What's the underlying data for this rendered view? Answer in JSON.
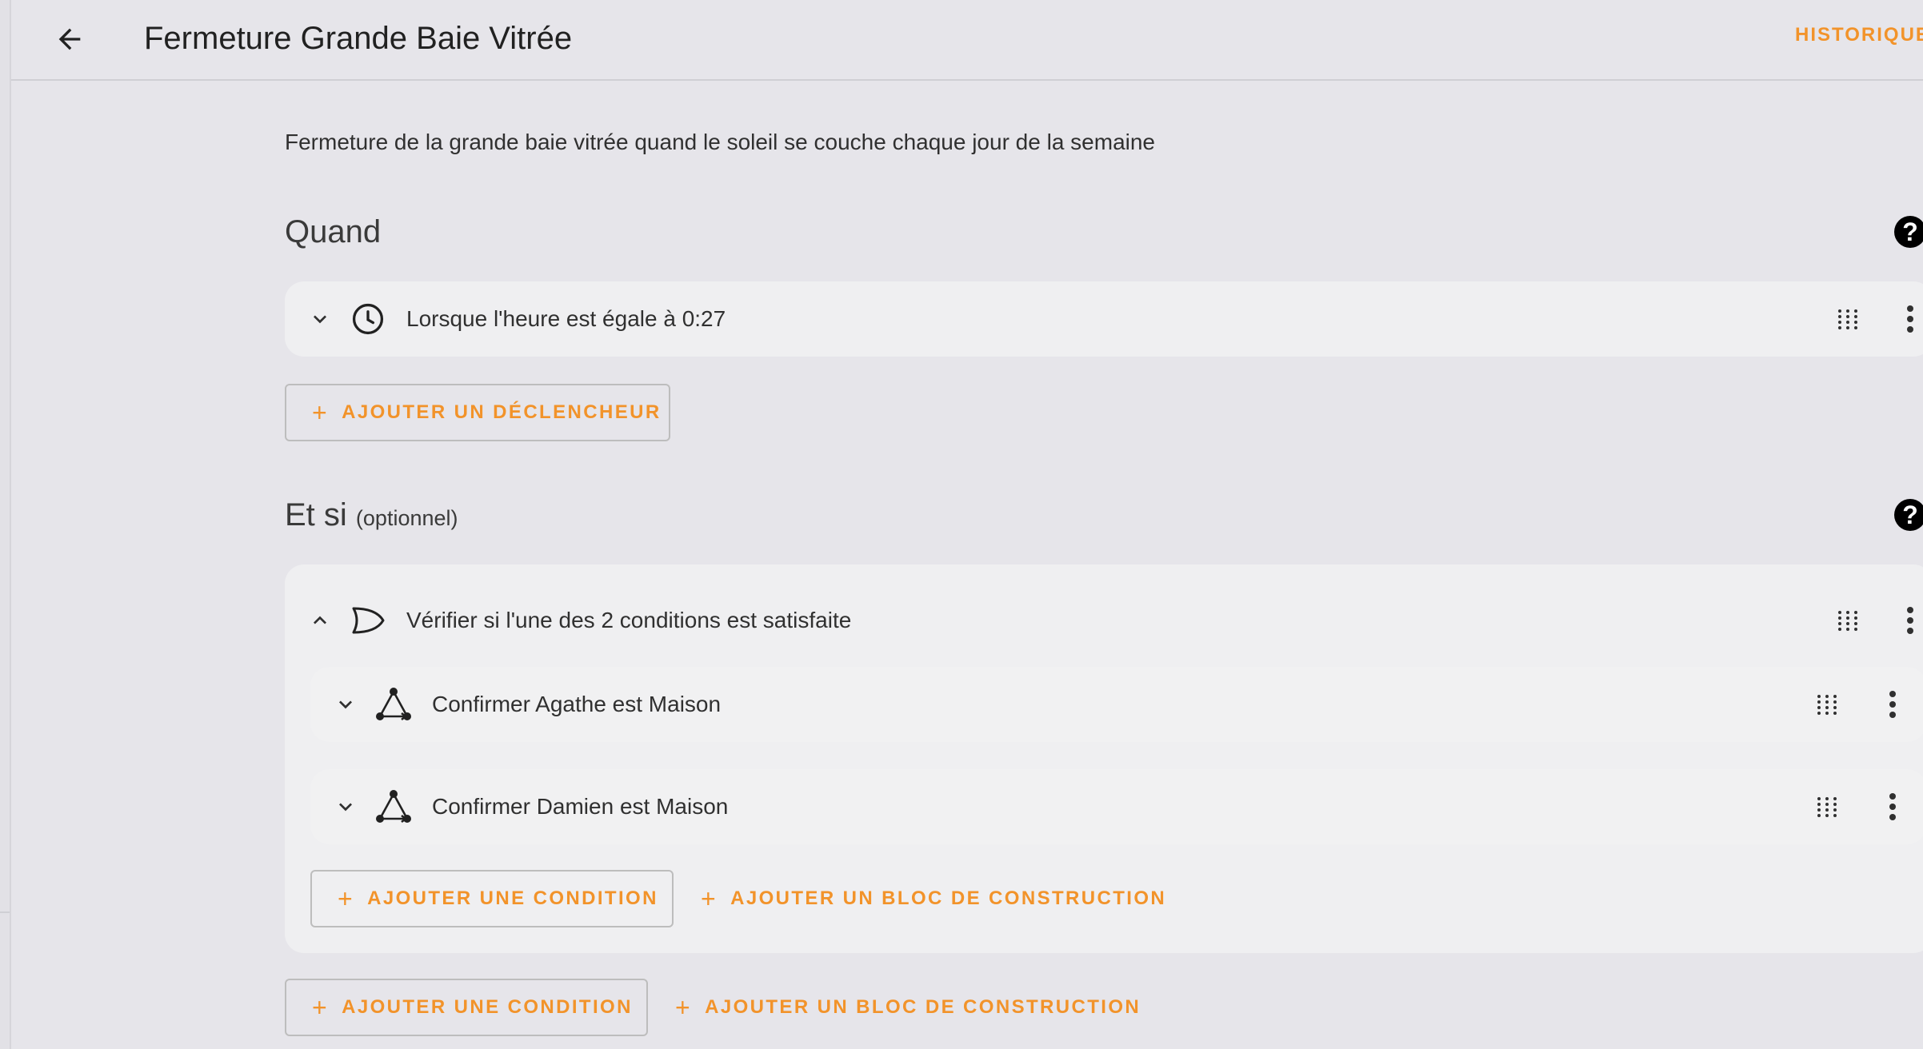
{
  "header": {
    "title": "Fermeture Grande Baie Vitrée",
    "history_label": "HISTORIQUE"
  },
  "description": "Fermeture de la grande baie vitrée quand le soleil se couche chaque jour de la semaine",
  "triggers_section": {
    "title": "Quand",
    "items": [
      {
        "label": "Lorsque l'heure est égale à 0:27",
        "icon": "clock-icon"
      }
    ],
    "add_trigger_label": "AJOUTER UN DÉCLENCHEUR"
  },
  "conditions_section": {
    "title": "Et si",
    "optional": "(optionnel)",
    "group": {
      "label": "Vérifier si l'une des 2 conditions est satisfaite",
      "icon": "or-gate-icon",
      "items": [
        {
          "label": "Confirmer Agathe est Maison",
          "icon": "state-graph-icon"
        },
        {
          "label": "Confirmer Damien est Maison",
          "icon": "state-graph-icon"
        }
      ],
      "add_condition_label": "AJOUTER UNE CONDITION",
      "add_block_label": "AJOUTER UN BLOC DE CONSTRUCTION"
    },
    "add_condition_label": "AJOUTER UNE CONDITION",
    "add_block_label": "AJOUTER UN BLOC DE CONSTRUCTION"
  },
  "colors": {
    "accent": "#f2932a",
    "background": "#e6e5ea",
    "card": "#efeff1"
  }
}
